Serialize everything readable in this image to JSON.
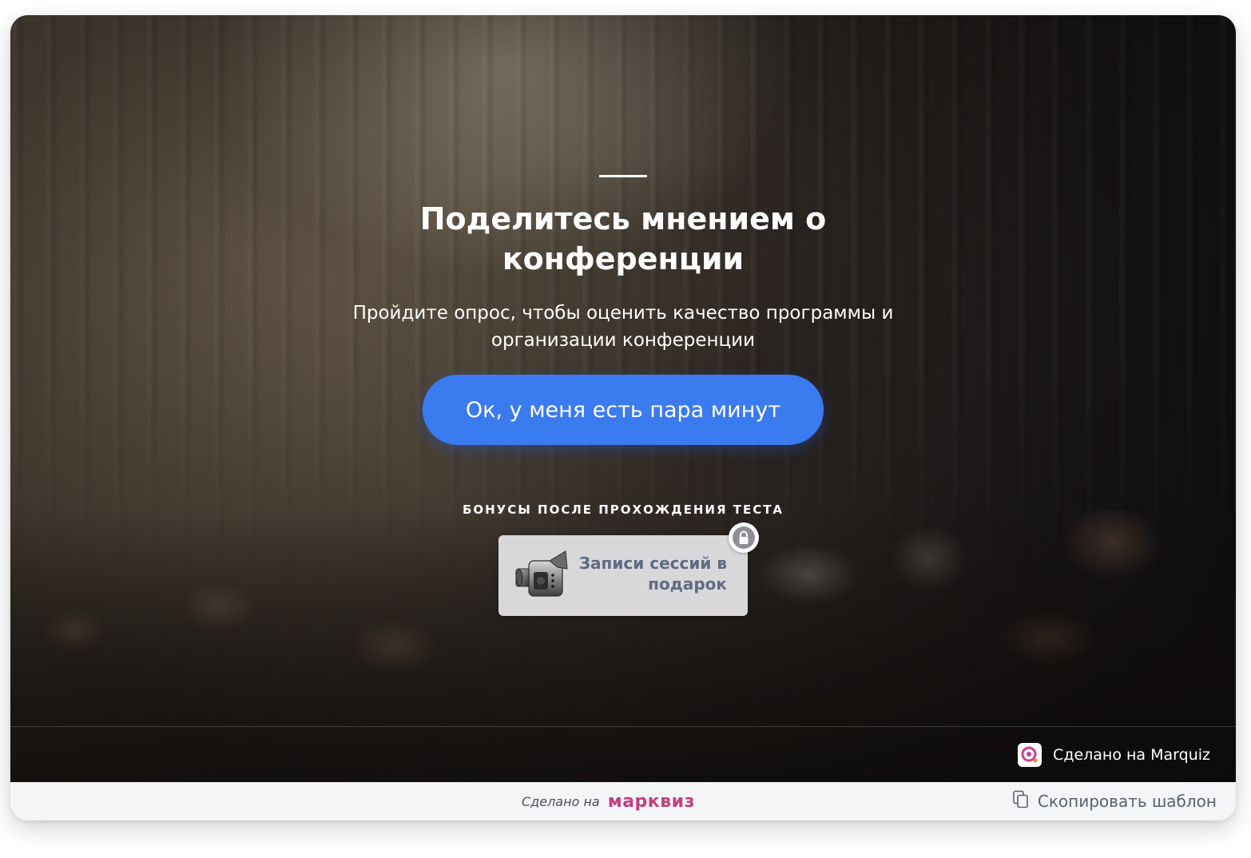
{
  "hero": {
    "title": "Поделитесь мнением о конференции",
    "subtitle": "Пройдите опрос, чтобы оценить качество программы и организации конференции",
    "cta_label": "Ок, у меня есть пара минут",
    "bonus_heading": "БОНУСЫ ПОСЛЕ ПРОХОЖДЕНИЯ ТЕСТА",
    "bonus_items": [
      {
        "label": "Записи сессий в подарок",
        "icon": "video-camera-icon",
        "locked": true
      }
    ],
    "credit_label": "Сделано на Marquiz"
  },
  "footer": {
    "made_label": "Сделано на",
    "brand": "марквиз",
    "copy_label": "Скопировать шаблон"
  },
  "colors": {
    "accent": "#3b7bf0",
    "brand": "#c2407f",
    "bonus_text": "#5f6b82"
  }
}
